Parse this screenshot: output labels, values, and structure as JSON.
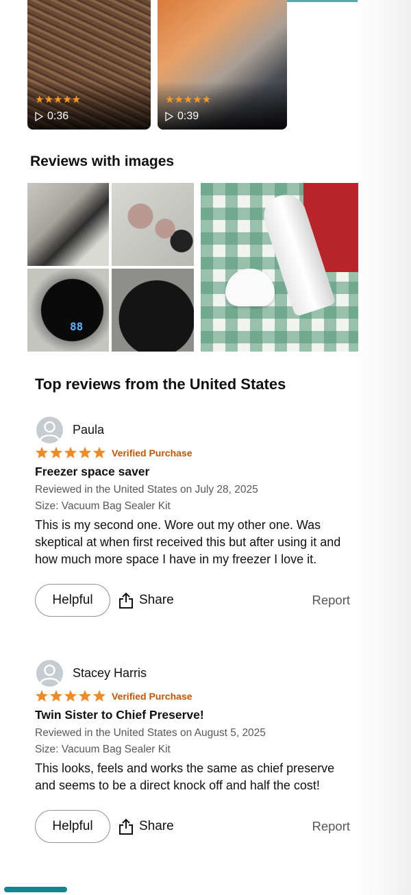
{
  "video_reviews": [
    {
      "stars": "★★★★★",
      "duration": "0:36"
    },
    {
      "stars": "★★★★★",
      "duration": "0:39"
    }
  ],
  "reviews_with_images": {
    "heading": "Reviews with images",
    "display_digits": "88"
  },
  "top_reviews": {
    "heading": "Top reviews from the United States",
    "reviews": [
      {
        "name": "Paula",
        "rating": 5,
        "verified": "Verified Purchase",
        "title": "Freezer space saver",
        "reviewed": "Reviewed in the United States on July 28, 2025",
        "size": "Size: Vacuum Bag Sealer Kit",
        "body": "This is my second one. Wore out my other one. Was skeptical at when first received this but after using it and how much more space I have in my freezer I love it.",
        "helpful": "Helpful",
        "share": "Share",
        "report": "Report"
      },
      {
        "name": "Stacey Harris",
        "rating": 5,
        "verified": "Verified Purchase",
        "title": "Twin Sister to Chief Preserve!",
        "reviewed": "Reviewed in the United States on August 5, 2025",
        "size": "Size: Vacuum Bag Sealer Kit",
        "body": "This looks, feels and works the same as chief preserve and seems to be a direct knock off and half the cost!",
        "helpful": "Helpful",
        "share": "Share",
        "report": "Report"
      }
    ]
  },
  "colors": {
    "star": "#f08a24",
    "verified": "#c45500",
    "accent": "#128593"
  }
}
